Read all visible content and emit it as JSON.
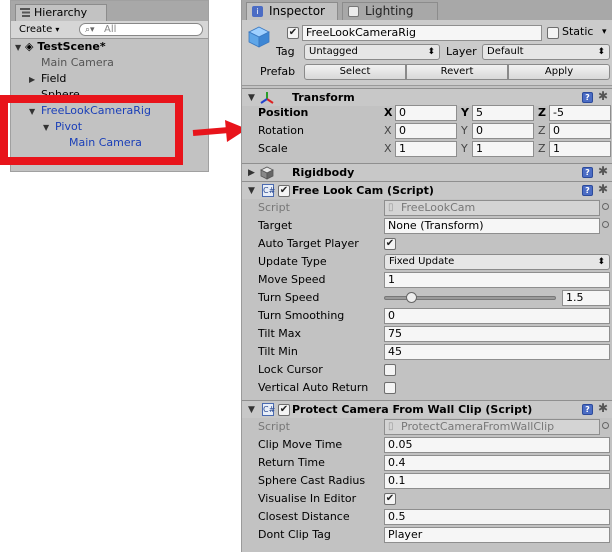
{
  "hierarchy": {
    "tab_label": "Hierarchy",
    "create_label": "Create",
    "search_placeholder": "All",
    "items": [
      {
        "label": "TestScene*"
      },
      {
        "label": "Main Camera"
      },
      {
        "label": "Field"
      },
      {
        "label": "Sphere"
      },
      {
        "label": "FreeLookCameraRig"
      },
      {
        "label": "Pivot"
      },
      {
        "label": "Main Camera"
      }
    ]
  },
  "inspector": {
    "tabs": [
      "Inspector",
      "Lighting"
    ],
    "object_name": "FreeLookCameraRig",
    "static_label": "Static",
    "tag_label": "Tag",
    "tag_value": "Untagged",
    "layer_label": "Layer",
    "layer_value": "Default",
    "prefab_label": "Prefab",
    "prefab_buttons": [
      "Select",
      "Revert",
      "Apply"
    ]
  },
  "transform": {
    "title": "Transform",
    "rows": [
      {
        "label": "Position",
        "x": "0",
        "y": "5",
        "z": "-5"
      },
      {
        "label": "Rotation",
        "x": "0",
        "y": "0",
        "z": "0"
      },
      {
        "label": "Scale",
        "x": "1",
        "y": "1",
        "z": "1"
      }
    ],
    "axes": [
      "X",
      "Y",
      "Z"
    ]
  },
  "rigidbody": {
    "title": "Rigidbody"
  },
  "free_look": {
    "title": "Free Look Cam (Script)",
    "script_label": "Script",
    "script_value": "FreeLookCam",
    "target_label": "Target",
    "target_value": "None (Transform)",
    "auto_target_label": "Auto Target Player",
    "auto_target_checked": true,
    "update_type_label": "Update Type",
    "update_type_value": "Fixed Update",
    "move_speed_label": "Move Speed",
    "move_speed_value": "1",
    "turn_speed_label": "Turn Speed",
    "turn_speed_value": "1.5",
    "turn_smoothing_label": "Turn Smoothing",
    "turn_smoothing_value": "0",
    "tilt_max_label": "Tilt Max",
    "tilt_max_value": "75",
    "tilt_min_label": "Tilt Min",
    "tilt_min_value": "45",
    "lock_cursor_label": "Lock Cursor",
    "lock_cursor_checked": false,
    "vertical_auto_return_label": "Vertical Auto Return",
    "vertical_auto_return_checked": false
  },
  "protect_camera": {
    "title": "Protect Camera From Wall Clip (Script)",
    "script_label": "Script",
    "script_value": "ProtectCameraFromWallClip",
    "clip_move_time_label": "Clip Move Time",
    "clip_move_time_value": "0.05",
    "return_time_label": "Return Time",
    "return_time_value": "0.4",
    "sphere_cast_radius_label": "Sphere Cast Radius",
    "sphere_cast_radius_value": "0.1",
    "visualise_label": "Visualise In Editor",
    "visualise_checked": true,
    "closest_distance_label": "Closest Distance",
    "closest_distance_value": "0.5",
    "dont_clip_tag_label": "Dont Clip Tag",
    "dont_clip_tag_value": "Player"
  },
  "colors": {
    "highlight": "#e8141b",
    "selection_text": "#1a3fb8"
  }
}
